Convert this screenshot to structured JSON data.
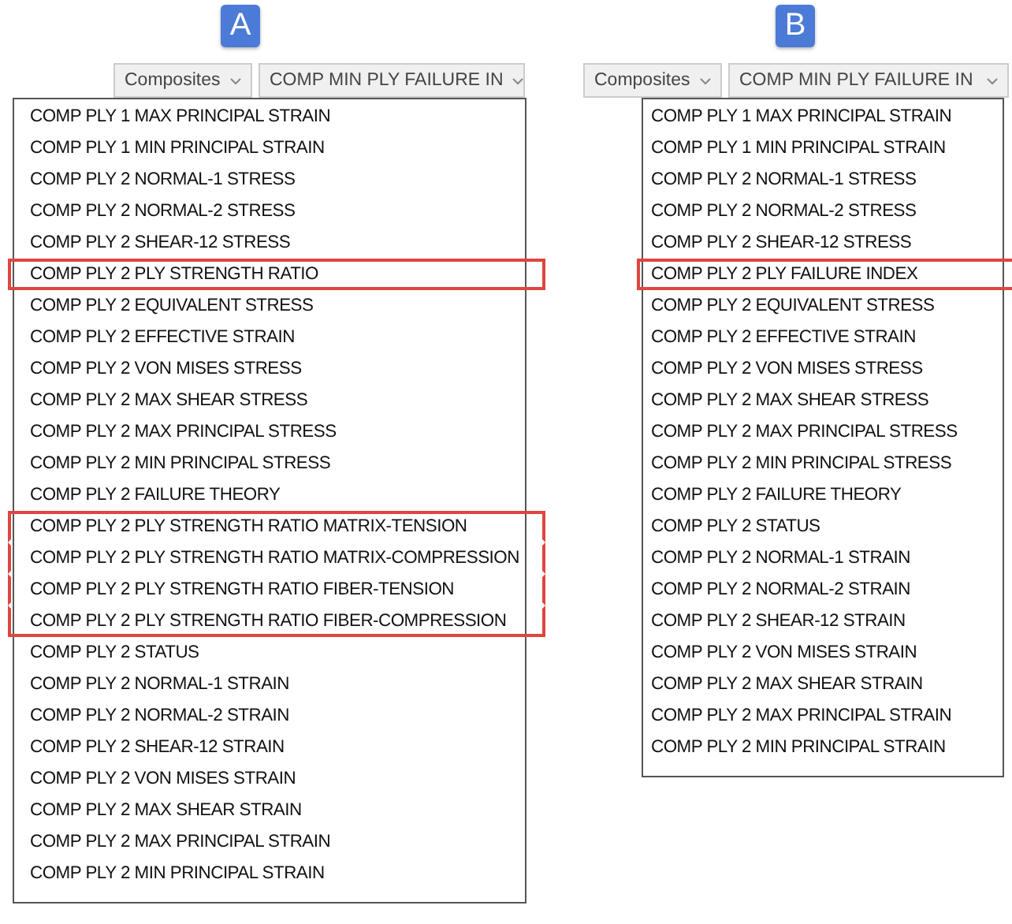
{
  "panels": [
    {
      "badge": "A",
      "dropdowns": [
        {
          "value": "Composites"
        },
        {
          "value": "COMP MIN PLY FAILURE IN"
        }
      ],
      "items": [
        {
          "label": "COMP PLY 1 MAX PRINCIPAL STRAIN",
          "highlighted": false
        },
        {
          "label": "COMP PLY 1 MIN PRINCIPAL STRAIN",
          "highlighted": false
        },
        {
          "label": "COMP PLY 2 NORMAL-1 STRESS",
          "highlighted": false
        },
        {
          "label": "COMP PLY 2 NORMAL-2 STRESS",
          "highlighted": false
        },
        {
          "label": "COMP PLY 2 SHEAR-12 STRESS",
          "highlighted": false
        },
        {
          "label": "COMP PLY 2 PLY STRENGTH RATIO",
          "highlighted": true
        },
        {
          "label": "COMP PLY 2 EQUIVALENT STRESS",
          "highlighted": false
        },
        {
          "label": "COMP PLY 2 EFFECTIVE STRAIN",
          "highlighted": false
        },
        {
          "label": "COMP PLY 2 VON MISES STRESS",
          "highlighted": false
        },
        {
          "label": "COMP PLY 2 MAX SHEAR STRESS",
          "highlighted": false
        },
        {
          "label": "COMP PLY 2 MAX PRINCIPAL STRESS",
          "highlighted": false
        },
        {
          "label": "COMP PLY 2 MIN PRINCIPAL STRESS",
          "highlighted": false
        },
        {
          "label": "COMP PLY 2 FAILURE THEORY",
          "highlighted": false
        },
        {
          "label": "COMP PLY 2 PLY STRENGTH RATIO MATRIX-TENSION",
          "highlighted": true
        },
        {
          "label": "COMP PLY 2 PLY STRENGTH RATIO MATRIX-COMPRESSION",
          "highlighted": true
        },
        {
          "label": "COMP PLY 2 PLY STRENGTH RATIO FIBER-TENSION",
          "highlighted": true
        },
        {
          "label": "COMP PLY 2 PLY STRENGTH RATIO FIBER-COMPRESSION",
          "highlighted": true
        },
        {
          "label": "COMP PLY 2 STATUS",
          "highlighted": false
        },
        {
          "label": "COMP PLY 2 NORMAL-1 STRAIN",
          "highlighted": false
        },
        {
          "label": "COMP PLY 2 NORMAL-2 STRAIN",
          "highlighted": false
        },
        {
          "label": "COMP PLY 2 SHEAR-12 STRAIN",
          "highlighted": false
        },
        {
          "label": "COMP PLY 2 VON MISES STRAIN",
          "highlighted": false
        },
        {
          "label": "COMP PLY 2 MAX SHEAR STRAIN",
          "highlighted": false
        },
        {
          "label": "COMP PLY 2 MAX PRINCIPAL STRAIN",
          "highlighted": false
        },
        {
          "label": "COMP PLY 2 MIN PRINCIPAL STRAIN",
          "highlighted": false
        }
      ]
    },
    {
      "badge": "B",
      "dropdowns": [
        {
          "value": "Composites"
        },
        {
          "value": "COMP MIN PLY FAILURE IN"
        }
      ],
      "items": [
        {
          "label": "COMP PLY 1 MAX PRINCIPAL STRAIN",
          "highlighted": false
        },
        {
          "label": "COMP PLY 1 MIN PRINCIPAL STRAIN",
          "highlighted": false
        },
        {
          "label": "COMP PLY 2 NORMAL-1 STRESS",
          "highlighted": false
        },
        {
          "label": "COMP PLY 2 NORMAL-2 STRESS",
          "highlighted": false
        },
        {
          "label": "COMP PLY 2 SHEAR-12 STRESS",
          "highlighted": false
        },
        {
          "label": "COMP PLY 2 PLY FAILURE INDEX",
          "highlighted": true
        },
        {
          "label": "COMP PLY 2 EQUIVALENT STRESS",
          "highlighted": false
        },
        {
          "label": "COMP PLY 2 EFFECTIVE STRAIN",
          "highlighted": false
        },
        {
          "label": "COMP PLY 2 VON MISES STRESS",
          "highlighted": false
        },
        {
          "label": "COMP PLY 2 MAX SHEAR STRESS",
          "highlighted": false
        },
        {
          "label": "COMP PLY 2 MAX PRINCIPAL STRESS",
          "highlighted": false
        },
        {
          "label": "COMP PLY 2 MIN PRINCIPAL STRESS",
          "highlighted": false
        },
        {
          "label": "COMP PLY 2 FAILURE THEORY",
          "highlighted": false
        },
        {
          "label": "COMP PLY 2 STATUS",
          "highlighted": false
        },
        {
          "label": "COMP PLY 2 NORMAL-1 STRAIN",
          "highlighted": false
        },
        {
          "label": "COMP PLY 2 NORMAL-2 STRAIN",
          "highlighted": false
        },
        {
          "label": "COMP PLY 2 SHEAR-12 STRAIN",
          "highlighted": false
        },
        {
          "label": "COMP PLY 2 VON MISES STRAIN",
          "highlighted": false
        },
        {
          "label": "COMP PLY 2 MAX SHEAR STRAIN",
          "highlighted": false
        },
        {
          "label": "COMP PLY 2 MAX PRINCIPAL STRAIN",
          "highlighted": false
        },
        {
          "label": "COMP PLY 2 MIN PRINCIPAL STRAIN",
          "highlighted": false
        }
      ]
    }
  ]
}
